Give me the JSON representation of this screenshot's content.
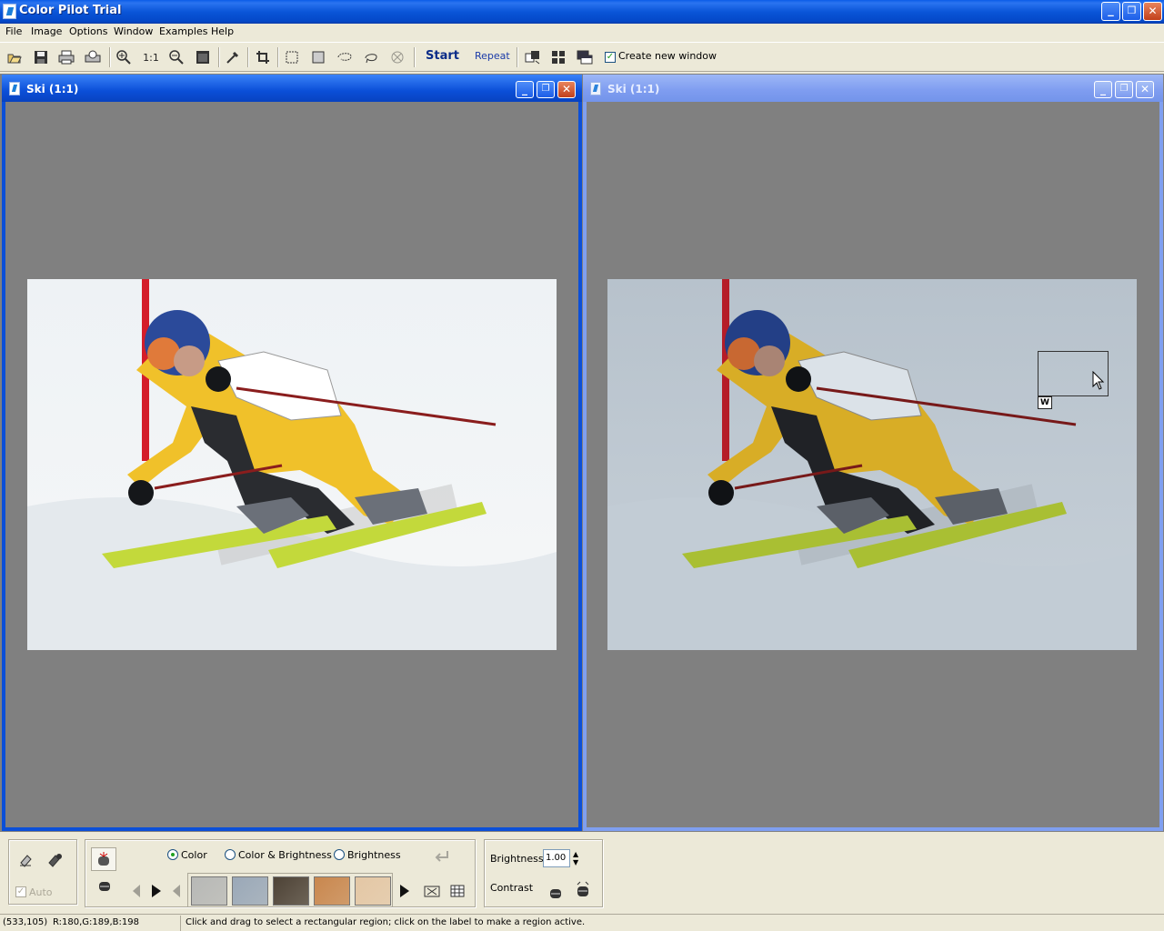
{
  "window": {
    "title": "Color Pilot Trial",
    "min": "_",
    "max": "❐",
    "close": "✕"
  },
  "menu": [
    "File",
    "Image",
    "Options",
    "Window",
    "Examples",
    "Help"
  ],
  "toolbar": {
    "zoom_1_1": "1:1",
    "start": "Start",
    "repeat": "Repeat",
    "create_new_window": "Create new window",
    "create_new_window_checked": true
  },
  "children": [
    {
      "title": "Ski (1:1)",
      "active": true
    },
    {
      "title": "Ski (1:1)",
      "active": false
    }
  ],
  "selection": {
    "label": "W"
  },
  "bottom": {
    "auto_label": "Auto",
    "mode_options": [
      "Color",
      "Color & Brightness",
      "Brightness"
    ],
    "mode_selected": "Color",
    "swatch_colors": [
      "#b7b8b6",
      "#9aa8b8",
      "#4d4236",
      "#c9874e",
      "#e4c7a5"
    ],
    "brightness_label": "Brightness",
    "brightness_value": "1.00",
    "contrast_label": "Contrast"
  },
  "status": {
    "coords": "(533,105)",
    "rgb": "R:180,G:189,B:198",
    "hint": "Click and drag to select a rectangular region; click on the label to make a region active."
  }
}
